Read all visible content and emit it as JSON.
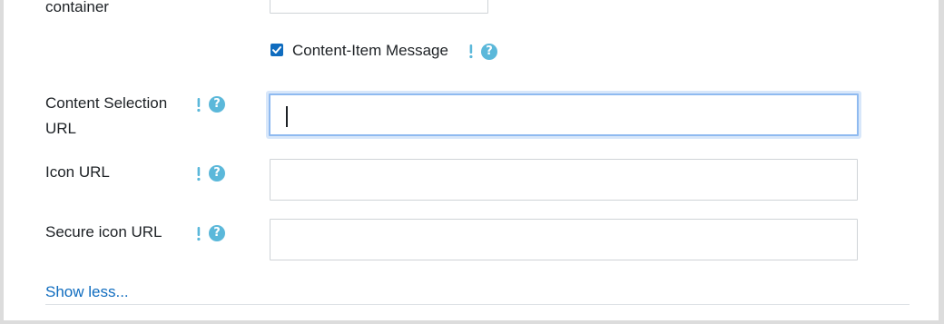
{
  "top_partial": {
    "label": "container"
  },
  "content_item_message": {
    "label": "Content-Item Message",
    "checked": true
  },
  "fields": [
    {
      "label_line1": "Content Selection",
      "label_line2": "URL",
      "value": ""
    },
    {
      "label": "Icon URL",
      "value": ""
    },
    {
      "label": "Secure icon URL",
      "value": ""
    }
  ],
  "icons": {
    "required": "exclamation-icon",
    "help": "help-icon",
    "help_glyph": "?"
  },
  "colors": {
    "help_bg": "#5bb8da",
    "link": "#0f6cbf",
    "focus_border": "#8fbaf0",
    "checkbox": "#0f6cbf"
  },
  "footer": {
    "show_less_link": "Show less..."
  }
}
